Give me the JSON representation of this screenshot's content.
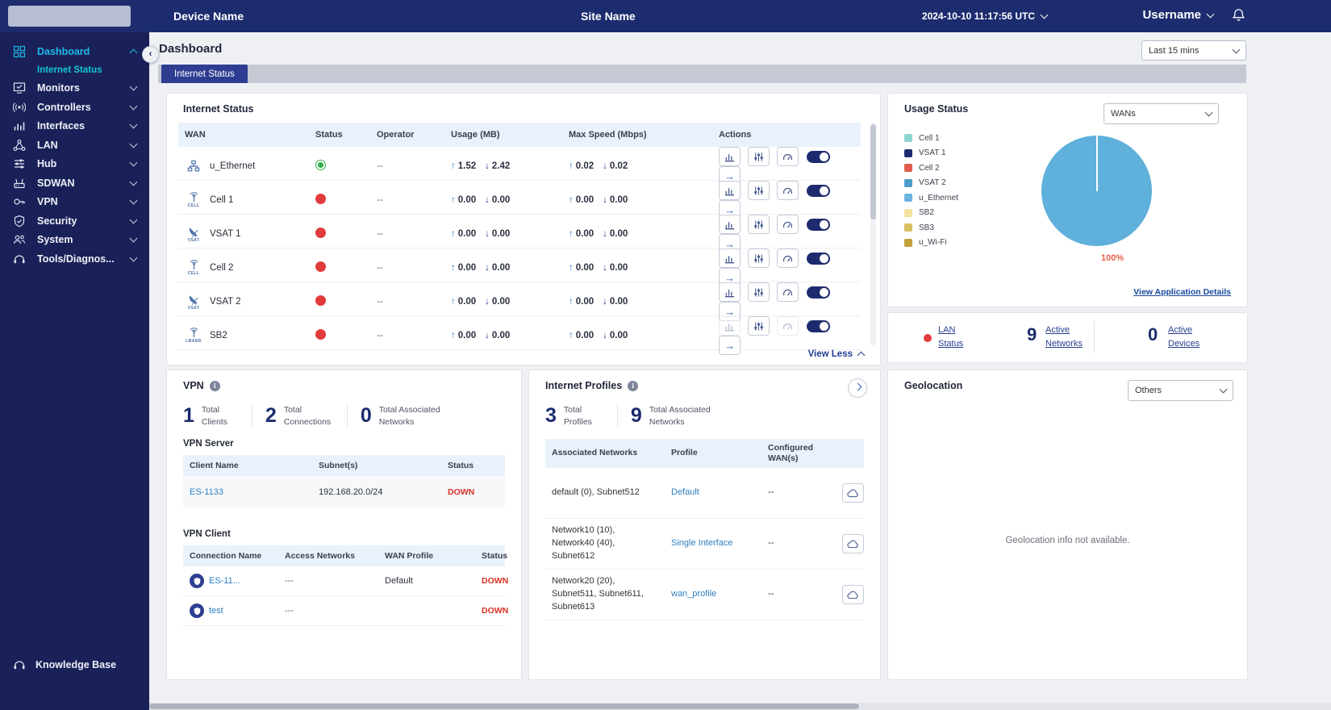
{
  "topbar": {
    "device_name": "Device Name",
    "site_name": "Site Name",
    "timestamp": "2024-10-10 11:17:56 UTC",
    "username": "Username"
  },
  "sidebar": {
    "dashboard": "Dashboard",
    "dashboard_sub": "Internet Status",
    "items": [
      "Monitors",
      "Controllers",
      "Interfaces",
      "LAN",
      "Hub",
      "SDWAN",
      "VPN",
      "Security",
      "System",
      "Tools/Diagnos..."
    ],
    "knowledge_base": "Knowledge Base"
  },
  "page": {
    "title": "Dashboard",
    "time_filter": "Last 15 mins",
    "active_tab": "Internet Status"
  },
  "internet_status": {
    "title": "Internet Status",
    "columns": [
      "WAN",
      "Status",
      "Operator",
      "Usage (MB)",
      "Max Speed (Mbps)",
      "Actions"
    ],
    "rows": [
      {
        "wan": "u_Ethernet",
        "icon_label": "",
        "status": "up",
        "operator": "--",
        "usage_up": "1.52",
        "usage_down": "2.42",
        "max_up": "0.02",
        "max_down": "0.02"
      },
      {
        "wan": "Cell 1",
        "icon_label": "CELL",
        "status": "down",
        "operator": "--",
        "usage_up": "0.00",
        "usage_down": "0.00",
        "max_up": "0.00",
        "max_down": "0.00"
      },
      {
        "wan": "VSAT 1",
        "icon_label": "VSAT",
        "status": "down",
        "operator": "--",
        "usage_up": "0.00",
        "usage_down": "0.00",
        "max_up": "0.00",
        "max_down": "0.00"
      },
      {
        "wan": "Cell 2",
        "icon_label": "CELL",
        "status": "down",
        "operator": "--",
        "usage_up": "0.00",
        "usage_down": "0.00",
        "max_up": "0.00",
        "max_down": "0.00"
      },
      {
        "wan": "VSAT 2",
        "icon_label": "VSAT",
        "status": "down",
        "operator": "--",
        "usage_up": "0.00",
        "usage_down": "0.00",
        "max_up": "0.00",
        "max_down": "0.00"
      },
      {
        "wan": "SB2",
        "icon_label": "LBAND",
        "status": "down",
        "operator": "--",
        "usage_up": "0.00",
        "usage_down": "0.00",
        "max_up": "0.00",
        "max_down": "0.00"
      }
    ],
    "view_less": "View Less"
  },
  "usage_status": {
    "title": "Usage Status",
    "filter": "WANs",
    "legend": [
      {
        "label": "Cell 1",
        "color": "#8fd6d2"
      },
      {
        "label": "VSAT 1",
        "color": "#1d2b6e"
      },
      {
        "label": "Cell 2",
        "color": "#e05c4b"
      },
      {
        "label": "VSAT 2",
        "color": "#4d9bc9"
      },
      {
        "label": "u_Ethernet",
        "color": "#6ab5de"
      },
      {
        "label": "SB2",
        "color": "#f2e3a0"
      },
      {
        "label": "SB3",
        "color": "#d9c060"
      },
      {
        "label": "u_Wi-Fi",
        "color": "#c2a138"
      }
    ],
    "pie": {
      "label": "100%",
      "color": "#5fb0da",
      "label_color": "#e8604c"
    },
    "details_link": "View Application Details"
  },
  "lan_status": {
    "label": "LAN Status",
    "networks_value": "9",
    "networks_label": "Active Networks",
    "devices_value": "0",
    "devices_label": "Active Devices"
  },
  "vpn": {
    "title": "VPN",
    "stats": [
      {
        "value": "1",
        "label": "Total Clients"
      },
      {
        "value": "2",
        "label": "Total Connections"
      },
      {
        "value": "0",
        "label": "Total Associated Networks"
      }
    ],
    "server": {
      "heading": "VPN Server",
      "columns": [
        "Client Name",
        "Subnet(s)",
        "Status"
      ],
      "rows": [
        {
          "client": "ES-1133",
          "subnets": "192.168.20.0/24",
          "status": "DOWN"
        }
      ]
    },
    "client": {
      "heading": "VPN Client",
      "columns": [
        "Connection Name",
        "Access Networks",
        "WAN Profile",
        "Status"
      ],
      "rows": [
        {
          "name": "ES-11...",
          "access": "---",
          "wan_profile": "Default",
          "status": "DOWN"
        },
        {
          "name": "test",
          "access": "---",
          "wan_profile": "",
          "status": "DOWN"
        }
      ]
    }
  },
  "internet_profiles": {
    "title": "Internet Profiles",
    "stats": [
      {
        "value": "3",
        "label": "Total Profiles"
      },
      {
        "value": "9",
        "label": "Total Associated Networks"
      }
    ],
    "columns": [
      "Associated Networks",
      "Profile",
      "Configured WAN(s)"
    ],
    "rows": [
      {
        "networks": "default (0), Subnet512",
        "profile": "Default",
        "wans": "--"
      },
      {
        "networks": "Network10 (10), Network40 (40), Subnet612",
        "profile": "Single Interface",
        "wans": "--"
      },
      {
        "networks": "Network20 (20), Subnet511, Subnet611, Subnet613",
        "profile": "wan_profile",
        "wans": "--"
      }
    ]
  },
  "geolocation": {
    "title": "Geolocation",
    "filter": "Others",
    "empty_text": "Geolocation info not available."
  }
}
